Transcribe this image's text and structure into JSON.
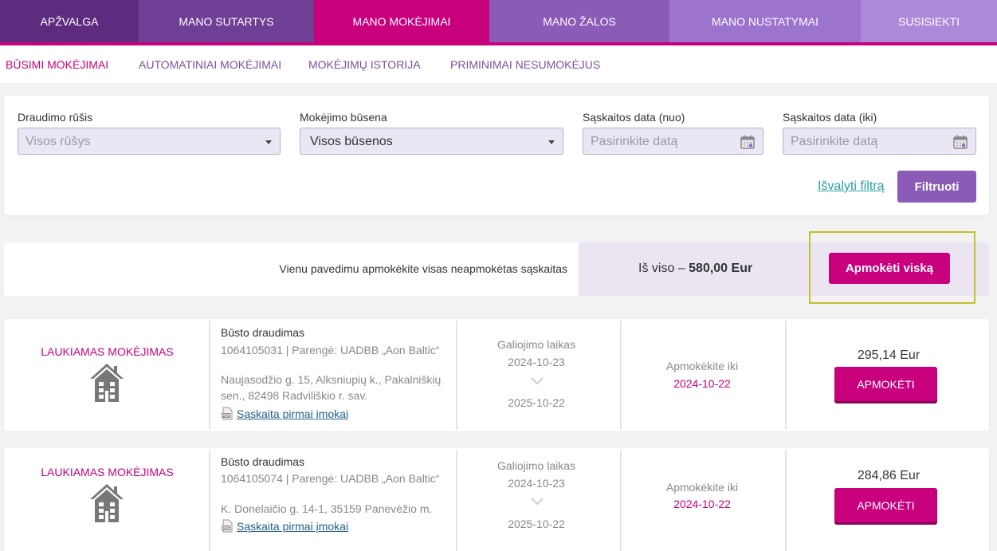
{
  "nav": {
    "tabs": [
      {
        "label": "APŽVALGA",
        "color": "#5e2c7e"
      },
      {
        "label": "MANO SUTARTYS",
        "color": "#6e3f94"
      },
      {
        "label": "MANO MOKĖJIMAI",
        "color": "#c8007e"
      },
      {
        "label": "MANO ŽALOS",
        "color": "#8a5cb8"
      },
      {
        "label": "MANO NUSTATYMAI",
        "color": "#9d74cd"
      },
      {
        "label": "SUSISIEKTI",
        "color": "#ad8ad9"
      }
    ]
  },
  "subnav": {
    "items": [
      "BŪSIMI MOKĖJIMAI",
      "AUTOMATINIAI MOKĖJIMAI",
      "MOKĖJIMŲ ISTORIJA",
      "PRIMINIMAI NESUMOKĖJUS"
    ]
  },
  "filters": {
    "type_label": "Draudimo rūšis",
    "type_value": "Visos rūšys",
    "status_label": "Mokėjimo būsena",
    "status_value": "Visos būsenos",
    "date_from_label": "Sąskaitos data (nuo)",
    "date_from_placeholder": "Pasirinkite datą",
    "date_to_label": "Sąskaitos data (iki)",
    "date_to_placeholder": "Pasirinkite datą",
    "clear_label": "Išvalyti filtrą",
    "filter_button": "Filtruoti"
  },
  "summary": {
    "pay_all_text": "Vienu pavedimu apmokėkite visas neapmokėtas sąskaitas",
    "total_prefix": "Iš viso – ",
    "total_amount": "580,00 Eur",
    "pay_all_button": "Apmokėti viską"
  },
  "payments": [
    {
      "status": "LAUKIAMAS MOKĖJIMAS",
      "title": "Būsto draudimas",
      "number": "1064105031 | Parengė: UADBB „Aon Baltic“",
      "address": "Naujasodžio g. 15, Alksniupių k., Pakalniškių sen., 82498 Radviliškio r. sav.",
      "invoice_link": "Sąskaita pirmai įmokai",
      "validity_label": "Galiojimo laikas",
      "valid_from": "2024-10-23",
      "valid_to": "2025-10-22",
      "due_label": "Apmokėkite iki",
      "due_date": "2024-10-22",
      "amount": "295,14 Eur",
      "pay_button": "APMOKĖTI"
    },
    {
      "status": "LAUKIAMAS MOKĖJIMAS",
      "title": "Būsto draudimas",
      "number": "1064105074 | Parengė: UADBB „Aon Baltic“",
      "address": "K. Donelaičio g. 14-1, 35159 Panevėžio m.",
      "invoice_link": "Sąskaita pirmai įmokai",
      "validity_label": "Galiojimo laikas",
      "valid_from": "2024-10-23",
      "valid_to": "2025-10-22",
      "due_label": "Apmokėkite iki",
      "due_date": "2024-10-22",
      "amount": "284,86 Eur",
      "pay_button": "APMOKĖTI"
    }
  ]
}
